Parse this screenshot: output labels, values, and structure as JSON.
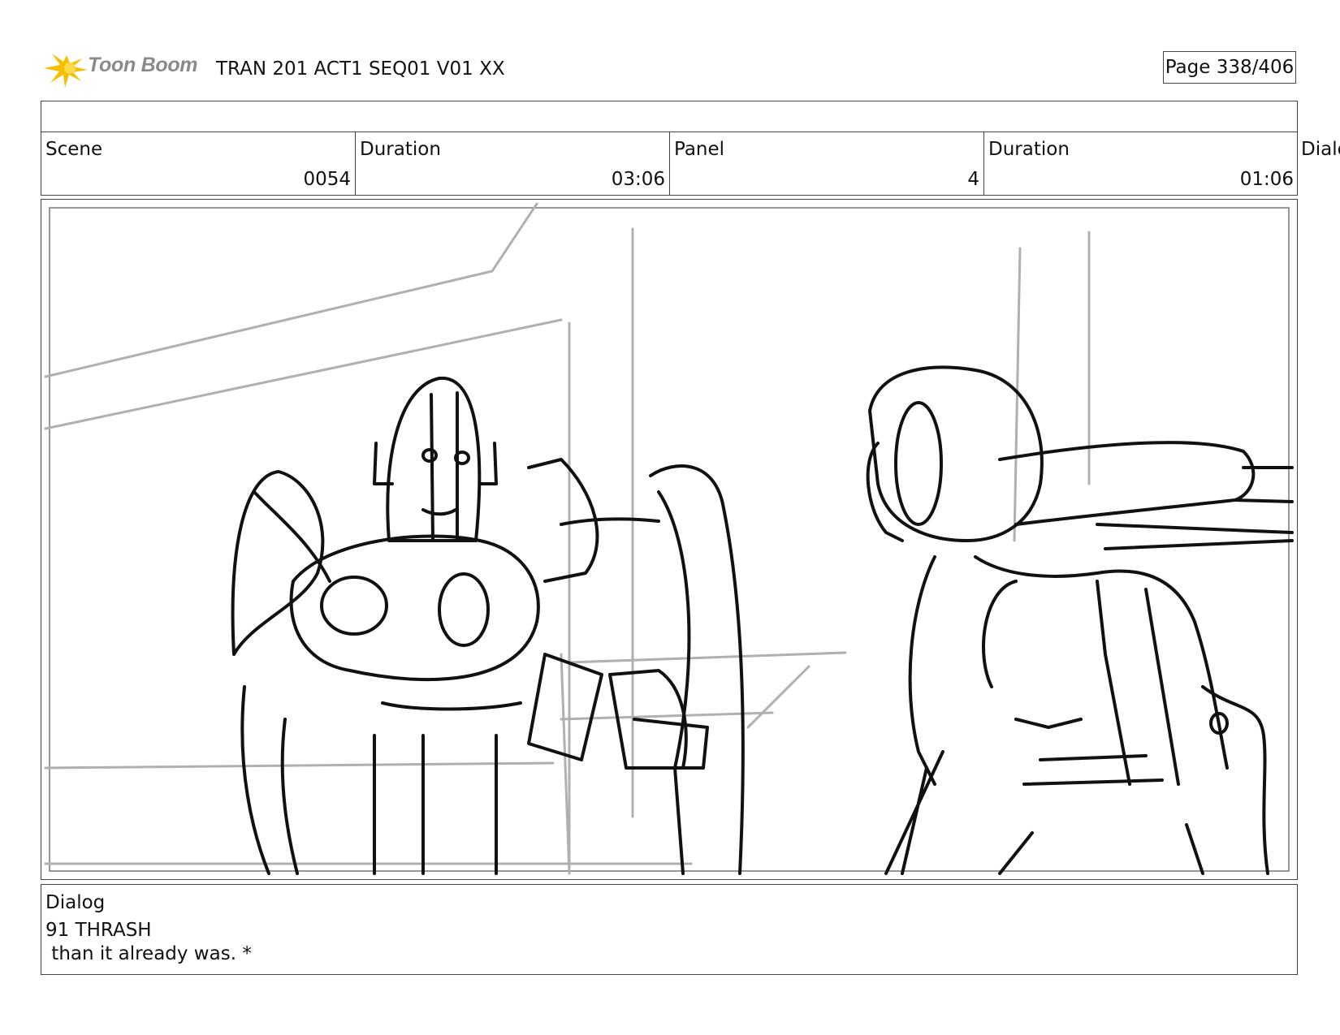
{
  "header": {
    "logo_text": "Toon Boom",
    "title": "TRAN 201 ACT1 SEQ01 V01 XX",
    "page": "Page 338/406"
  },
  "info": {
    "scene_label": "Scene",
    "scene_value": "0054",
    "duration_label": "Duration",
    "duration_value": "03:06",
    "panel_label": "Panel",
    "panel_value": "4",
    "panel_duration_label": "Duration",
    "panel_duration_value": "01:06",
    "overflow_label": "Dialo"
  },
  "dialog": {
    "label": "Dialog",
    "line1": "91 THRASH",
    "line2": " than it already was. *"
  },
  "colors": {
    "logo_star": "#f5c000",
    "logo_text": "#8a8a8a",
    "sketch_line": "#111111",
    "guide_line": "#b0b0b0"
  }
}
